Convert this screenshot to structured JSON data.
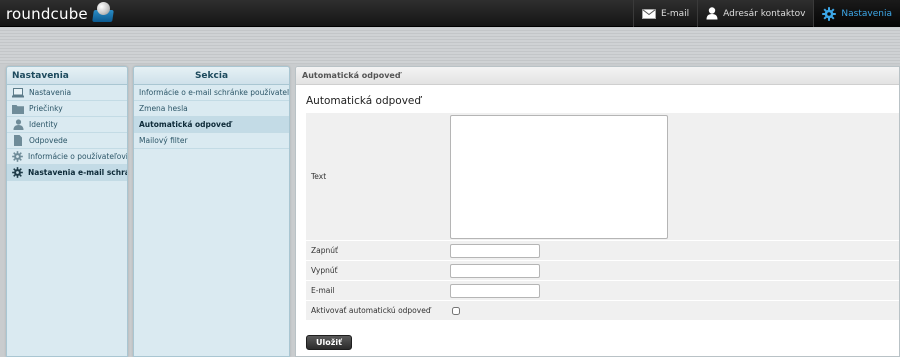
{
  "app": {
    "logo_text": "roundcube"
  },
  "topnav": {
    "items": [
      {
        "label": "E-mail",
        "icon": "mail-icon",
        "selected": false
      },
      {
        "label": "Adresár kontaktov",
        "icon": "contact-icon",
        "selected": false
      },
      {
        "label": "Nastavenia",
        "icon": "gear-icon",
        "selected": true
      }
    ]
  },
  "nav": {
    "header": "Nastavenia",
    "items": [
      {
        "label": "Nastavenia",
        "icon": "laptop-icon"
      },
      {
        "label": "Priečinky",
        "icon": "folder-icon"
      },
      {
        "label": "Identity",
        "icon": "person-icon"
      },
      {
        "label": "Odpovede",
        "icon": "document-icon"
      },
      {
        "label": "Informácie o používateľovi",
        "icon": "gear-icon"
      },
      {
        "label": "Nastavenia e-mail schránky",
        "icon": "gear-icon",
        "selected": true
      }
    ]
  },
  "sections": {
    "header": "Sekcia",
    "items": [
      {
        "label": "Informácie o e-mail schránke používateľa"
      },
      {
        "label": "Zmena hesla"
      },
      {
        "label": "Automatická odpoveď",
        "selected": true
      },
      {
        "label": "Mailový filter"
      }
    ]
  },
  "content": {
    "header": "Automatická odpoveď",
    "form_title": "Automatická odpoveď",
    "fields": {
      "text_label": "Text",
      "text_value": "",
      "enable_label": "Zapnúť",
      "enable_value": "",
      "disable_label": "Vypnúť",
      "disable_value": "",
      "email_label": "E-mail",
      "email_value": "",
      "activate_label": "Aktivovať automatickú odpoveď",
      "activate_checked": false
    },
    "save_label": "Uložiť"
  },
  "colors": {
    "accent": "#3da7e8",
    "panel_bg": "#daeaf1",
    "topbar_bg": "#1f1f1f"
  }
}
